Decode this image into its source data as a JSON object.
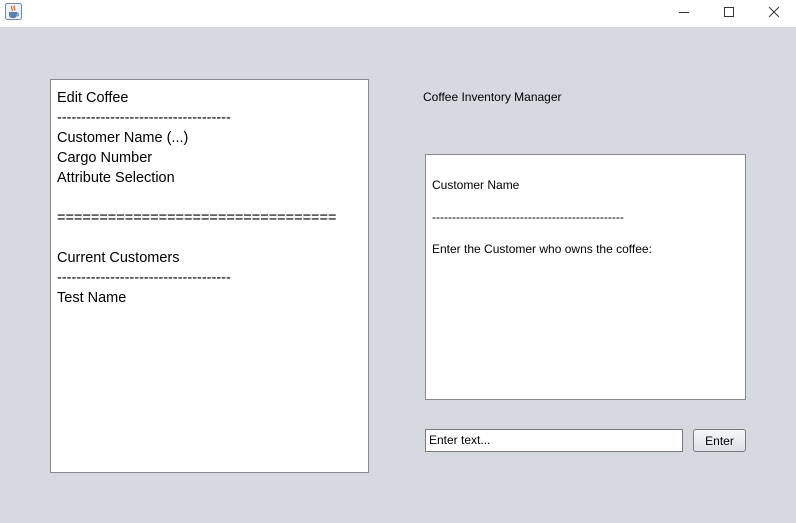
{
  "window": {
    "app_icon": "java-coffee-cup-icon",
    "controls": [
      "minimize-icon",
      "maximize-icon",
      "close-icon"
    ]
  },
  "menu_panel": {
    "lines": "Edit Coffee\n------------------------------------\nCustomer Name (...)\nCargo Number\nAttribute Selection\n\n=================================\n\nCurrent Customers\n------------------------------------\nTest Name"
  },
  "app_title": "Coffee Inventory Manager",
  "prompt_panel": {
    "lines": "Customer Name\n\n------------------------------------------------\n\nEnter the Customer who owns the coffee:"
  },
  "input": {
    "value": "Enter text..."
  },
  "enter_button": {
    "label": "Enter"
  },
  "colors": {
    "window_bg": "#d6d9e0",
    "panel_bg": "#ffffff",
    "titlebar_bg": "#ffffff"
  }
}
